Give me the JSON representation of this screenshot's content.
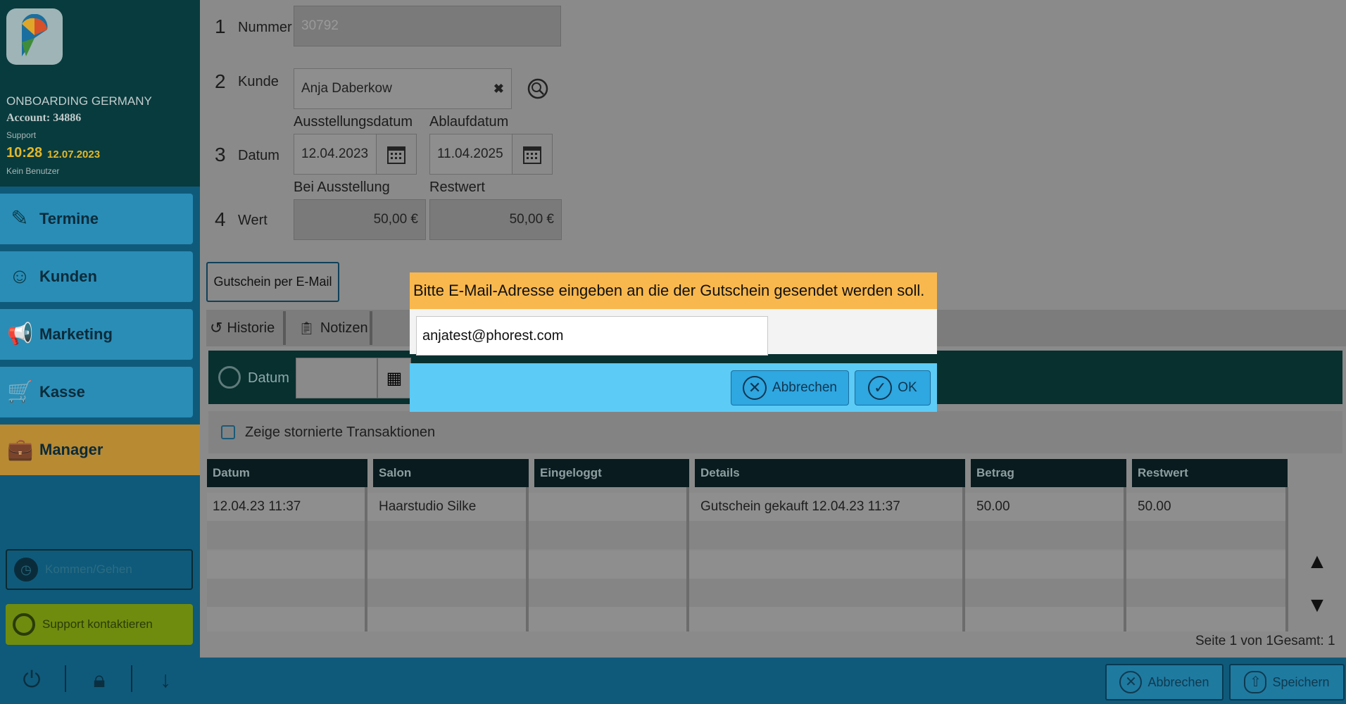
{
  "sidebar": {
    "company": "ONBOARDING GERMANY",
    "account": "Account: 34886",
    "role": "Support",
    "time": "10:28",
    "date": "12.07.2023",
    "user": "Kein Benutzer",
    "nav": [
      {
        "label": "Termine",
        "icon": "calendar-edit-icon"
      },
      {
        "label": "Kunden",
        "icon": "customer-head-icon"
      },
      {
        "label": "Marketing",
        "icon": "megaphone-icon"
      },
      {
        "label": "Kasse",
        "icon": "shopping-cart-icon"
      },
      {
        "label": "Manager",
        "icon": "briefcase-icon"
      }
    ],
    "kommen_gehen": "Kommen/Gehen",
    "support": "Support kontaktieren"
  },
  "form": {
    "nummer": {
      "index": "1",
      "label": "Nummer",
      "placeholder": "30792"
    },
    "kunde": {
      "index": "2",
      "label": "Kunde",
      "value": "Anja Daberkow"
    },
    "datum": {
      "index": "3",
      "label": "Datum",
      "issue_label": "Ausstellungsdatum",
      "issue_value": "12.04.2023",
      "expiry_label": "Ablaufdatum",
      "expiry_value": "11.04.2025"
    },
    "wert": {
      "index": "4",
      "label": "Wert",
      "issue_label": "Bei Ausstellung",
      "issue_value": "50,00 €",
      "rest_label": "Restwert",
      "rest_value": "50,00 €"
    },
    "email_button": "Gutschein per E-Mail"
  },
  "tabs": [
    {
      "label": "Historie",
      "icon": "history-icon"
    },
    {
      "label": "Notizen",
      "icon": "clipboard-icon"
    }
  ],
  "filter": {
    "label": "Datum",
    "show_cancelled": "Zeige stornierte Transaktionen"
  },
  "table": {
    "headers": [
      "Datum",
      "Salon",
      "Eingeloggt",
      "Details",
      "Betrag",
      "Restwert"
    ],
    "rows": [
      [
        "12.04.23 11:37",
        "Haarstudio Silke",
        "",
        "Gutschein gekauft 12.04.23 11:37",
        "50.00",
        "50.00"
      ]
    ],
    "paging": "Seite 1 von 1Gesamt: 1"
  },
  "footer": {
    "cancel": "Abbrechen",
    "save": "Speichern"
  },
  "modal": {
    "title": "Bitte E-Mail-Adresse eingeben an die der Gutschein gesendet werden soll.",
    "email": "anjatest@phorest.com",
    "cancel": "Abbrechen",
    "ok": "OK"
  },
  "colors": {
    "accent_orange": "#f9b84e",
    "modal_blue": "#5ccbf5",
    "sidebar_dark": "#083b3d"
  }
}
